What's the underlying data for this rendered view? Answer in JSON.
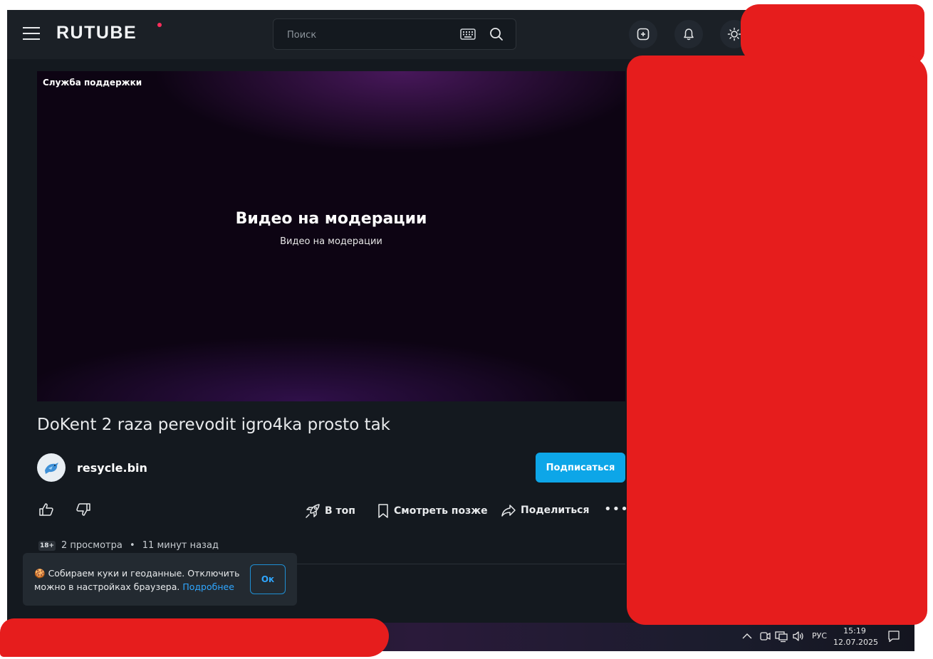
{
  "header": {
    "logo": "RUTUBE",
    "search_placeholder": "Поиск"
  },
  "player": {
    "support_label": "Служба поддержки",
    "moderation_title": "Видео на модерации",
    "moderation_subtitle": "Видео на модерации"
  },
  "video": {
    "title": "DoKent 2 raza perevodit igro4ka prosto tak",
    "channel": "resycle.bin",
    "subscribe_label": "Подписаться",
    "actions": {
      "top_label": "В топ",
      "watch_later_label": "Смотреть позже",
      "share_label": "Поделиться",
      "more_label": "•••"
    },
    "age_badge": "18+",
    "views": "2 просмотра",
    "separator": "•",
    "published": "11 минут назад"
  },
  "cookie": {
    "emoji": "🍪",
    "text": "Собираем куки и геоданные. Отключить можно в настройках браузера.",
    "link_label": "Подробнее",
    "ok_label": "Ок"
  },
  "taskbar": {
    "language": "РУС",
    "time": "15:19",
    "date": "12.07.2025"
  },
  "colors": {
    "accent": "#0da6e8",
    "background": "#14191f",
    "header": "#1b2026",
    "redaction": "#e61d1d"
  }
}
